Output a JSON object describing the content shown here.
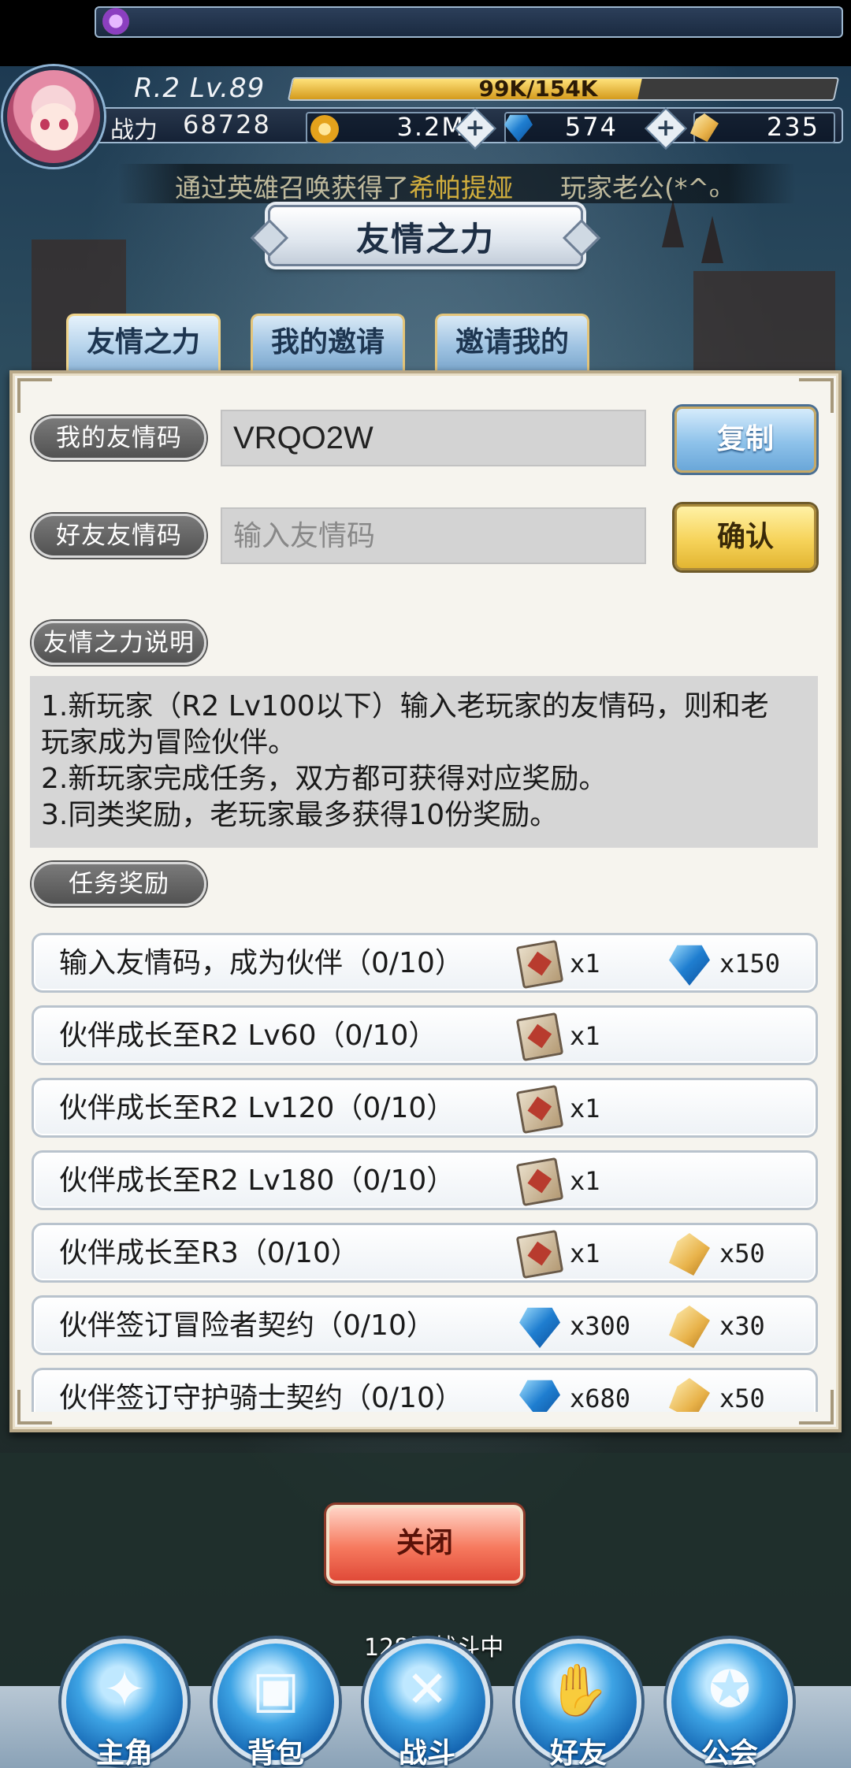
{
  "hud": {
    "rank_level": "R.2 Lv.89",
    "exp_text": "99K/154K",
    "exp_fraction": 0.64,
    "power_label": "战力",
    "power_value": "68728",
    "gold": "3.2M",
    "gems": "574",
    "scrolls": "235"
  },
  "marquee": {
    "prefix": "通过英雄召唤获得了",
    "highlight": "希帕提娅",
    "suffix": "玩家老公(*^ₒ"
  },
  "panel": {
    "title": "友情之力",
    "tabs": [
      "友情之力",
      "我的邀请",
      "邀请我的"
    ],
    "my_code_label": "我的友情码",
    "my_code_value": "VRQO2W",
    "copy_button": "复制",
    "friend_code_label": "好友友情码",
    "friend_code_placeholder": "输入友情码",
    "confirm_button": "确认",
    "desc_label": "友情之力说明",
    "desc_lines": [
      "1.新玩家（R2 Lv100以下）输入老玩家的友情码，则和老",
      "玩家成为冒险伙伴。",
      "2.新玩家完成任务，双方都可获得对应奖励。",
      "3.同类奖励，老玩家最多获得10份奖励。"
    ],
    "tasks_label": "任务奖励"
  },
  "tasks": [
    {
      "label": "输入友情码，成为伙伴（0/10）",
      "r1_icon": "card-icon",
      "r1": "x1",
      "r2_icon": "gem-icon",
      "r2": "x150"
    },
    {
      "label": "伙伴成长至R2 Lv60（0/10）",
      "r1_icon": "card-icon",
      "r1": "x1",
      "r2_icon": "",
      "r2": ""
    },
    {
      "label": "伙伴成长至R2 Lv120（0/10）",
      "r1_icon": "card-icon",
      "r1": "x1",
      "r2_icon": "",
      "r2": ""
    },
    {
      "label": "伙伴成长至R2 Lv180（0/10）",
      "r1_icon": "card-icon",
      "r1": "x1",
      "r2_icon": "",
      "r2": ""
    },
    {
      "label": "伙伴成长至R3（0/10）",
      "r1_icon": "card-icon",
      "r1": "x1",
      "r2_icon": "scroll-icon",
      "r2": "x50"
    },
    {
      "label": "伙伴签订冒险者契约（0/10）",
      "r1_icon": "gem-icon",
      "r1": "x300",
      "r2_icon": "scroll-icon",
      "r2": "x30"
    },
    {
      "label": "伙伴签订守护骑士契约（0/10）",
      "r1_icon": "gem-icon",
      "r1": "x680",
      "r2_icon": "scroll-icon",
      "r2": "x50"
    }
  ],
  "close_button": "关闭",
  "battle_status": "128层战斗中",
  "nav": [
    "主角",
    "背包",
    "战斗",
    "好友",
    "公会"
  ],
  "nav_icons": [
    "helmet-icon",
    "backpack-icon",
    "swords-icon",
    "handshake-icon",
    "guild-emblem-icon"
  ]
}
